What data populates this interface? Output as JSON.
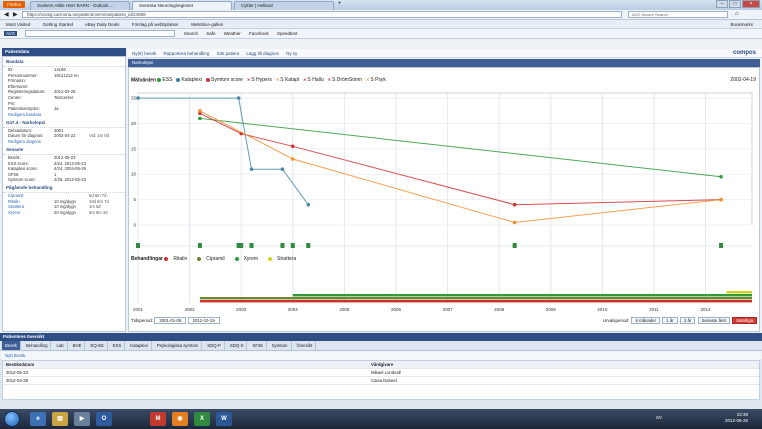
{
  "browser": {
    "firefox_label": "Firefox",
    "tabs": [
      {
        "label": "Soekers Attile HSH BARN - Outlook ..."
      },
      {
        "label": "Svenska Neurologiregistret"
      },
      {
        "label": "Cykler | Helland"
      }
    ],
    "new_tab": "+",
    "url": "https://novsg.carmona.se/patient/overview/patient_id/34599",
    "search_placeholder": "AVG Secure Search"
  },
  "bookmarks": [
    "Most Visited",
    "Getting Started",
    "eBay Daily Deals",
    "Förslag på webbplatser",
    "WebSlice-galleri"
  ],
  "avg_toolbar": [
    "Search",
    "Safe",
    "Weather",
    "Facebook",
    "Speedtest"
  ],
  "bookmarks_right": "Bookmarks",
  "toolbar": {
    "items": [
      "Ny(tt) besök",
      "Rapportera behandling",
      "Sök patient",
      "Lägg till diagnos",
      "Ny vy"
    ],
    "brand": "compos"
  },
  "left": {
    "header": "Patientdata",
    "basdata_title": "Basdata",
    "basdata": [
      {
        "k": "ID:",
        "v": "14168"
      },
      {
        "k": "Personnummer:",
        "v": "19121212-nn"
      },
      {
        "k": "Förnamn:",
        "v": ""
      },
      {
        "k": "Efternamn:",
        "v": ""
      },
      {
        "k": "Registreringsdatum:",
        "v": "2012-03-28"
      },
      {
        "k": "Center:",
        "v": "Testcenter"
      },
      {
        "k": "Pnr:",
        "v": ""
      },
      {
        "k": "Patientsamtycke:",
        "v": "Ja"
      }
    ],
    "basdata_link": "Redigera basdata",
    "diag_title": "G47.4 - Narkolepsi",
    "diag": [
      {
        "k": "Debutdatum:",
        "v": "2001"
      },
      {
        "k": "Datum för diagnos:",
        "v": "2002-04-22",
        "v2": "Vid: 1m 0d"
      }
    ],
    "diag_link": "Redigera diagnos",
    "latest_title": "Senaste",
    "latest": [
      {
        "k": "Besök:",
        "v": "2012-05-23"
      },
      {
        "k": "ESS score:",
        "v": "4/24, 2012-05-23"
      },
      {
        "k": "Kataplexi score:",
        "v": "4/24, 2004-06-28"
      },
      {
        "k": "SF36:",
        "v": "1"
      },
      {
        "k": "Symtom score:",
        "v": "2/26, 2012-05-23"
      }
    ],
    "treat_title": "Pågående behandling",
    "treat": [
      {
        "k": "Cipramil",
        "v": "",
        "v2": "5d 6m 7d"
      },
      {
        "k": "Ritalin",
        "v": "10 mg/dygn",
        "v2": "10d 6m 7d"
      },
      {
        "k": "Strattera",
        "v": "10 mg/dygn",
        "v2": "1m 6d"
      },
      {
        "k": "Xyrem",
        "v": "20 mg/dygn",
        "v2": "5m 6m 2d"
      }
    ]
  },
  "main": {
    "header": "Narkolepsi",
    "legend_title": "Mätvärden",
    "legend": [
      {
        "label": "ESS",
        "color": "#2f9a3a",
        "kind": "dot"
      },
      {
        "label": "Kataplexi",
        "color": "#3a7fa0",
        "kind": "dot"
      },
      {
        "label": "Symtom score",
        "color": "#d03030",
        "kind": "dot"
      },
      {
        "label": "S Hypers",
        "color": "#d03030",
        "kind": "x"
      },
      {
        "label": "S Katapl",
        "color": "#f09030",
        "kind": "x"
      },
      {
        "label": "S Hallu",
        "color": "#d03030",
        "kind": "x"
      },
      {
        "label": "S DrömSömn",
        "color": "#d03030",
        "kind": "x"
      },
      {
        "label": "S Psyk",
        "color": "#f09030",
        "kind": "x"
      }
    ],
    "date_right": "2002-04-19",
    "treat_legend_title": "Behandlingar",
    "treat_legend": [
      {
        "label": "Ritalin",
        "color": "#d03030"
      },
      {
        "label": "Cipramil",
        "color": "#6a8a2a"
      },
      {
        "label": "Xyrem",
        "color": "#2f9a3a"
      },
      {
        "label": "Strattera",
        "color": "#d8d020"
      }
    ],
    "period_label": "Tidsperiod:",
    "date_from": "2001-01-08",
    "date_to": "2012-10-19",
    "interval_label": "Urvalsperiod:",
    "interval_buttons": [
      "6 månader",
      "1 år",
      "2 år",
      "Senaste året",
      "Samtliga"
    ]
  },
  "chart_data": {
    "type": "line",
    "x_ticks": [
      "2001",
      "2002",
      "2003",
      "2004",
      "2005",
      "2006",
      "2007",
      "2008",
      "2009",
      "2010",
      "2011",
      "2012"
    ],
    "y_ticks": [
      "0",
      "5",
      "10",
      "15",
      "20",
      "25"
    ],
    "ylim": [
      0,
      26
    ],
    "xlim": [
      2001,
      2012.9
    ],
    "series": [
      {
        "name": "ESS",
        "color": "#2f9a3a",
        "points": [
          [
            2002.2,
            21
          ],
          [
            2012.3,
            9.5
          ]
        ]
      },
      {
        "name": "Kataplexi",
        "color": "#4a8aa8",
        "points": [
          [
            2001,
            25
          ],
          [
            2002.95,
            25
          ],
          [
            2003.2,
            11
          ],
          [
            2003.8,
            11
          ],
          [
            2004.3,
            4
          ]
        ]
      },
      {
        "name": "Symtom score",
        "color": "#d03030",
        "points": [
          [
            2002.2,
            22
          ],
          [
            2003,
            18
          ],
          [
            2004,
            15.5
          ],
          [
            2008.3,
            4
          ],
          [
            2012.3,
            5
          ]
        ]
      },
      {
        "name": "S Katapl",
        "color": "#f09030",
        "points": [
          [
            2002.2,
            22.5
          ],
          [
            2004,
            13
          ],
          [
            2008.3,
            0.5
          ],
          [
            2012.3,
            5
          ]
        ]
      }
    ],
    "treatments": [
      {
        "name": "Ritalin",
        "color": "#d03030",
        "start": 2002.2,
        "end": 2012.9
      },
      {
        "name": "Cipramil",
        "color": "#6a8a2a",
        "start": 2002.2,
        "end": 2012.9
      },
      {
        "name": "Xyrem",
        "color": "#2f9a3a",
        "start": 2004.0,
        "end": 2012.9
      },
      {
        "name": "Strattera",
        "color": "#d8d020",
        "start": 2012.4,
        "end": 2012.9
      }
    ]
  },
  "overview": {
    "header": "Patientens översikt",
    "tabs": [
      "Besök",
      "Behandling",
      "Lab",
      "BHE",
      "EQ-5D",
      "ESS",
      "Kataplexi",
      "Psykologiska symtom",
      "SDQ-P",
      "SDQ-S",
      "SF36",
      "Symtom",
      "Översikt"
    ],
    "button": "Nytt besök",
    "columns": [
      "Besöksdatum",
      "Vårdgivare"
    ],
    "rows": [
      {
        "date": "2012-05-23",
        "giver": "Mikael Lundvall"
      },
      {
        "date": "2012-03-28",
        "giver": "Caisa Dalund"
      }
    ]
  },
  "taskbar": {
    "lang": "SV",
    "time": "22:39",
    "date": "2012-06-26"
  }
}
